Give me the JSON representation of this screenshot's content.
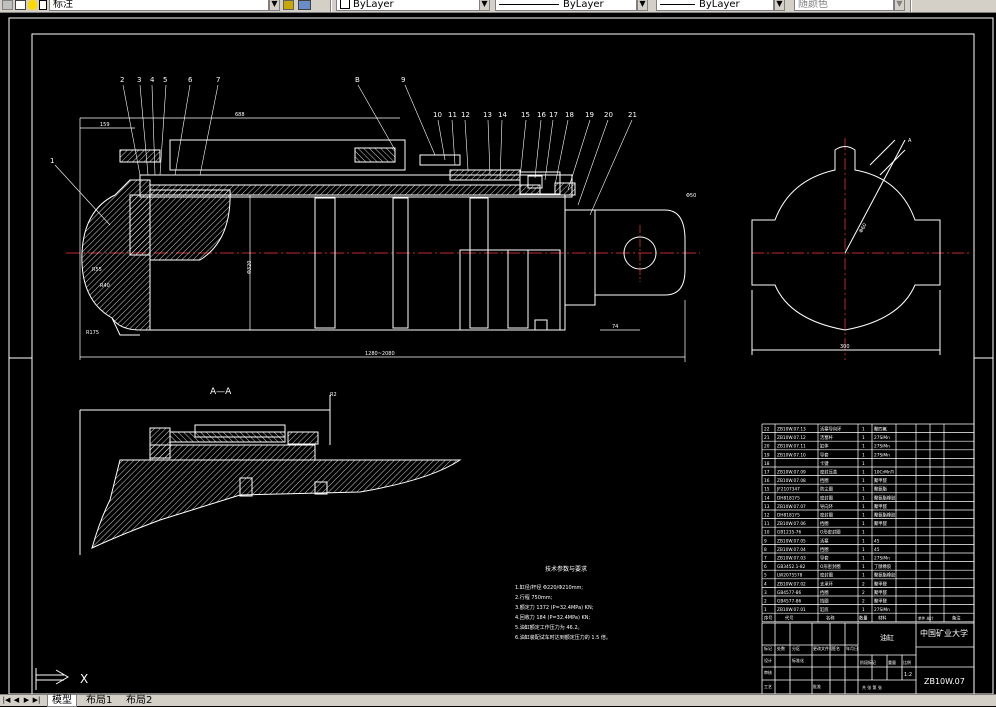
{
  "toolbar": {
    "style_name": "标注",
    "color_value": "ByLayer",
    "linetype_value": "ByLayer",
    "lineweight_value": "ByLayer",
    "plotstyle_value": "随颜色",
    "icons": [
      "layer-state-icon",
      "layer-icon",
      "lightbulb-icon",
      "sun-icon",
      "lock-icon",
      "color-swatch-icon",
      "layer-previous-icon",
      "layer-properties-icon"
    ]
  },
  "drawing": {
    "section_label": "A—A",
    "callouts": [
      "1",
      "2",
      "3",
      "4",
      "5",
      "6",
      "7",
      "8",
      "9",
      "10",
      "11",
      "12",
      "13",
      "14",
      "15",
      "16",
      "17",
      "18",
      "19",
      "20",
      "21"
    ],
    "callout_b": "B",
    "dims": {
      "d1": "159",
      "d2": "688",
      "d3": "1280~2080",
      "d4": "Φ320",
      "d5": "74",
      "d6": "300",
      "d7": "R2",
      "d8": "Φ50",
      "d9": "R55",
      "d10": "R40",
      "d11": "R175",
      "d12": "2×45°",
      "d13": "Φ60",
      "d14": "A"
    },
    "tech_title": "技术参数与要求",
    "tech_lines": [
      "1.缸径/杆径        Φ220/Φ210mm;",
      "2.行程             750mm;",
      "3.额定力           1372 (P=32.4MPa) KN;",
      "4.回收力           184 (P=32.4MPa) KN;",
      "5.油缸额定工作压力为 46.2。",
      "6.油缸装配试车时达到额定压力的 1.5 倍。"
    ]
  },
  "bom": {
    "rows": [
      {
        "no": "22",
        "code": "ZB10W.07.13",
        "name": "活塞导向环",
        "qty": "1",
        "mat": "聚四氟"
      },
      {
        "no": "21",
        "code": "ZB10W.07.12",
        "name": "活塞杆",
        "qty": "1",
        "mat": "27SiMn"
      },
      {
        "no": "20",
        "code": "ZB10W.07.11",
        "name": "缸体",
        "qty": "1",
        "mat": "27SiMn"
      },
      {
        "no": "19",
        "code": "ZB10W.07.10",
        "name": "导套",
        "qty": "1",
        "mat": "27SiMn"
      },
      {
        "no": "18",
        "code": "",
        "name": "卡键",
        "qty": "1",
        "mat": ""
      },
      {
        "no": "17",
        "code": "ZB10W.07.09",
        "name": "密封压盖",
        "qty": "1",
        "mat": "10CrMnTi"
      },
      {
        "no": "16",
        "code": "ZB10W.07.08",
        "name": "挡圈",
        "qty": "1",
        "mat": "聚甲醛"
      },
      {
        "no": "15",
        "code": "JF2107347",
        "name": "防尘圈",
        "qty": "1",
        "mat": "聚氨酯"
      },
      {
        "no": "14",
        "code": "DH8181Y5",
        "name": "密封圈",
        "qty": "1",
        "mat": "聚氨酯橡胶"
      },
      {
        "no": "13",
        "code": "ZB10W.07.07",
        "name": "导向环",
        "qty": "1",
        "mat": "聚甲醛"
      },
      {
        "no": "12",
        "code": "DH8181Y5",
        "name": "密封圈",
        "qty": "1",
        "mat": "聚氨酯橡胶"
      },
      {
        "no": "11",
        "code": "ZB10W.07.06",
        "name": "挡圈",
        "qty": "1",
        "mat": "聚甲醛"
      },
      {
        "no": "10",
        "code": "GB1235-76",
        "name": "O形密封圈",
        "qty": "1",
        "mat": ""
      },
      {
        "no": "9",
        "code": "ZB10W.07.05",
        "name": "活塞",
        "qty": "1",
        "mat": "45"
      },
      {
        "no": "8",
        "code": "ZB10W.07.04",
        "name": "挡圈",
        "qty": "1",
        "mat": "45"
      },
      {
        "no": "7",
        "code": "ZB10W.07.03",
        "name": "导套",
        "qty": "1",
        "mat": "27SiMn"
      },
      {
        "no": "6",
        "code": "GB3452.1-82",
        "name": "O形密封圈",
        "qty": "1",
        "mat": "丁腈橡胶"
      },
      {
        "no": "5",
        "code": "LW2075578",
        "name": "密封圈",
        "qty": "1",
        "mat": "聚氨酯橡胶"
      },
      {
        "no": "4",
        "code": "ZB10W.07.02",
        "name": "支承环",
        "qty": "2",
        "mat": "聚甲醛"
      },
      {
        "no": "3",
        "code": "GB4577-86",
        "name": "挡圈",
        "qty": "2",
        "mat": "聚甲醛"
      },
      {
        "no": "2",
        "code": "GB4577-86",
        "name": "挡圈",
        "qty": "2",
        "mat": "聚甲醛"
      },
      {
        "no": "1",
        "code": "ZB10W.07.01",
        "name": "缸底",
        "qty": "1",
        "mat": "27SiMn"
      }
    ],
    "header": {
      "no": "序号",
      "code": "代号",
      "name": "名称",
      "qty": "数量",
      "mat": "材料",
      "weight": "单件 总计",
      "remark": "备注"
    },
    "title_block": {
      "part_name": "油缸",
      "school": "中国矿业大学",
      "drawing_no": "ZB10W.07",
      "scale": "1:2",
      "sheet": "共 张 第 张",
      "labels": [
        "标记",
        "处数",
        "分区",
        "更改文件号",
        "签名",
        "年月日",
        "设计",
        "标准化",
        "审核",
        "工艺",
        "批准",
        "阶段标记",
        "重量",
        "比例"
      ]
    }
  },
  "layout_tabs": {
    "model": "模型",
    "layout1": "布局1",
    "layout2": "布局2"
  },
  "ucs": {
    "x_label": "X"
  }
}
